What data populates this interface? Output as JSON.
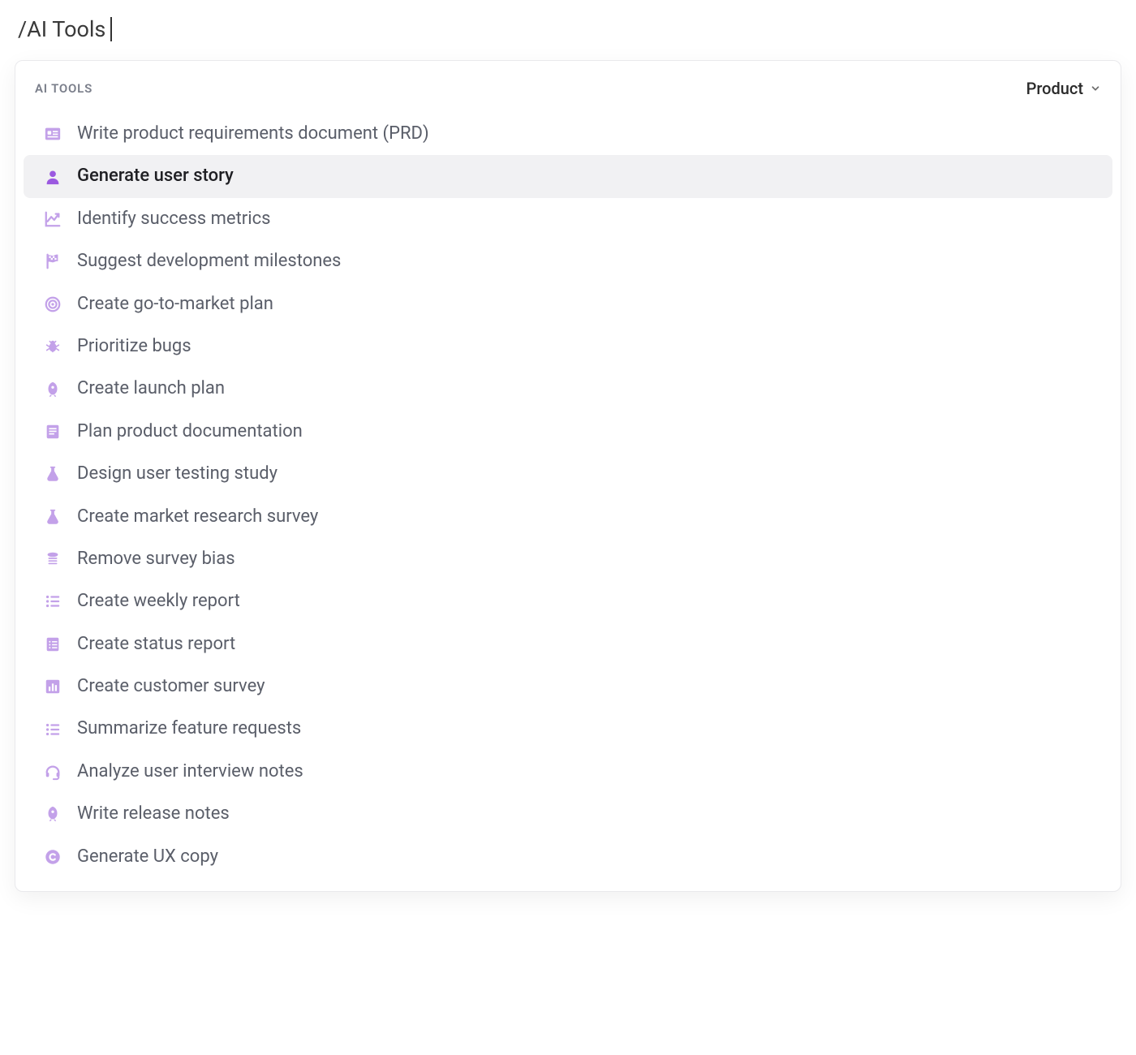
{
  "command_text": "/AI Tools",
  "panel": {
    "title": "AI TOOLS",
    "filter_label": "Product"
  },
  "tools": [
    {
      "label": "Write product requirements document (PRD)",
      "icon": "id-card-icon",
      "selected": false
    },
    {
      "label": "Generate user story",
      "icon": "user-icon",
      "selected": true
    },
    {
      "label": "Identify success metrics",
      "icon": "chart-line-icon",
      "selected": false
    },
    {
      "label": "Suggest development milestones",
      "icon": "flag-checkered-icon",
      "selected": false
    },
    {
      "label": "Create go-to-market plan",
      "icon": "bullseye-icon",
      "selected": false
    },
    {
      "label": "Prioritize bugs",
      "icon": "bug-icon",
      "selected": false
    },
    {
      "label": "Create launch plan",
      "icon": "rocket-icon",
      "selected": false
    },
    {
      "label": "Plan product documentation",
      "icon": "book-icon",
      "selected": false
    },
    {
      "label": "Design user testing study",
      "icon": "flask-icon",
      "selected": false
    },
    {
      "label": "Create market research survey",
      "icon": "flask-icon",
      "selected": false
    },
    {
      "label": "Remove survey bias",
      "icon": "balance-icon",
      "selected": false
    },
    {
      "label": "Create weekly report",
      "icon": "list-icon",
      "selected": false
    },
    {
      "label": "Create status report",
      "icon": "clipboard-list-icon",
      "selected": false
    },
    {
      "label": "Create customer survey",
      "icon": "bar-chart-icon",
      "selected": false
    },
    {
      "label": "Summarize feature requests",
      "icon": "list-icon",
      "selected": false
    },
    {
      "label": "Analyze user interview notes",
      "icon": "headset-icon",
      "selected": false
    },
    {
      "label": "Write release notes",
      "icon": "rocket-icon",
      "selected": false
    },
    {
      "label": "Generate UX copy",
      "icon": "copyright-icon",
      "selected": false
    }
  ],
  "colors": {
    "icon_light": "#C3A1E9",
    "icon_selected": "#9B59E0",
    "selected_bg": "#F1F1F3",
    "text_muted": "#5a5e69",
    "text_dark": "#1f1f23"
  }
}
